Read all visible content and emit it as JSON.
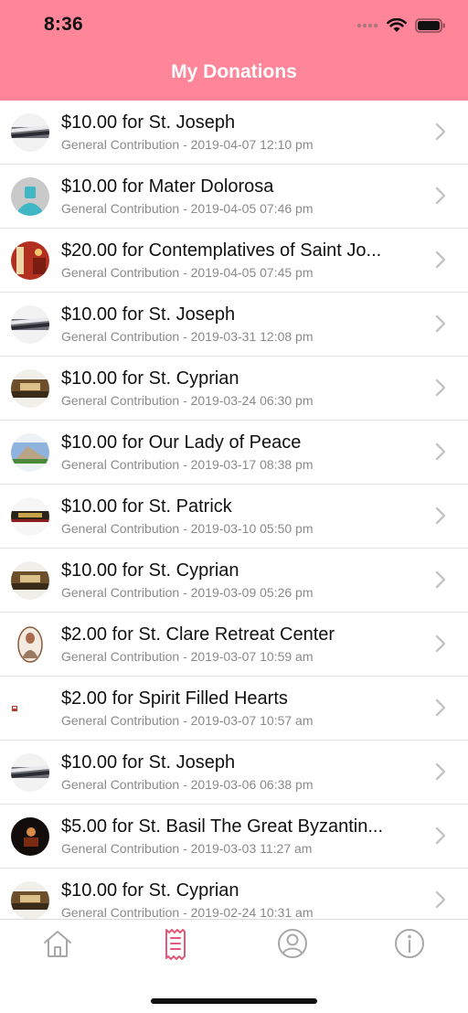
{
  "status_bar": {
    "time": "8:36"
  },
  "header": {
    "title": "My Donations"
  },
  "colors": {
    "header_bg": "#ff8599",
    "active_tab": "#e05a78",
    "inactive_tab": "#a8a8a8"
  },
  "donations": [
    {
      "title": "$10.00 for St. Joseph",
      "subtitle": "General Contribution - 2019-04-07 12:10 pm",
      "thumb": "pews-icon"
    },
    {
      "title": "$10.00 for Mater Dolorosa",
      "subtitle": "General Contribution - 2019-04-05 07:46 pm",
      "thumb": "default-avatar-icon"
    },
    {
      "title": "$20.00 for Contemplatives of Saint Jo...",
      "subtitle": "General Contribution - 2019-04-05 07:45 pm",
      "thumb": "chapel-icon"
    },
    {
      "title": "$10.00 for St. Joseph",
      "subtitle": "General Contribution - 2019-03-31 12:08 pm",
      "thumb": "pews-icon"
    },
    {
      "title": "$10.00 for St. Cyprian",
      "subtitle": "General Contribution - 2019-03-24 06:30 pm",
      "thumb": "church-interior-icon"
    },
    {
      "title": "$10.00 for Our Lady of Peace",
      "subtitle": "General Contribution - 2019-03-17 08:38 pm",
      "thumb": "church-exterior-icon"
    },
    {
      "title": "$10.00 for St. Patrick",
      "subtitle": "General Contribution - 2019-03-10 05:50 pm",
      "thumb": "altar-icon"
    },
    {
      "title": "$10.00 for St. Cyprian",
      "subtitle": "General Contribution - 2019-03-09 05:26 pm",
      "thumb": "church-interior-icon"
    },
    {
      "title": "$2.00 for St. Clare Retreat Center",
      "subtitle": "General Contribution - 2019-03-07 10:59 am",
      "thumb": "saint-portrait-icon"
    },
    {
      "title": "$2.00 for Spirit Filled Hearts",
      "subtitle": "General Contribution - 2019-03-07 10:57 am",
      "thumb": "logo-icon"
    },
    {
      "title": "$10.00 for St. Joseph",
      "subtitle": "General Contribution - 2019-03-06 06:38 pm",
      "thumb": "pews-icon"
    },
    {
      "title": "$5.00 for St. Basil The Great Byzantin...",
      "subtitle": "General Contribution - 2019-03-03 11:27 am",
      "thumb": "dark-altar-icon"
    },
    {
      "title": "$10.00 for St. Cyprian",
      "subtitle": "General Contribution - 2019-02-24 10:31 am",
      "thumb": "church-interior-icon"
    }
  ],
  "tabs": [
    {
      "name": "home-icon",
      "active": false
    },
    {
      "name": "receipt-icon",
      "active": true
    },
    {
      "name": "profile-icon",
      "active": false
    },
    {
      "name": "info-icon",
      "active": false
    }
  ]
}
